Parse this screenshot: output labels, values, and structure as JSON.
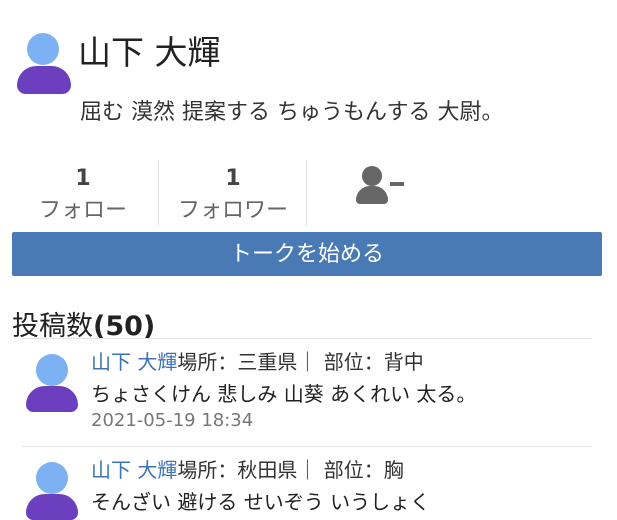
{
  "profile": {
    "name": "山下 大輝",
    "bio": "屈む 漠然 提案する ちゅうもんする 大尉。"
  },
  "stats": {
    "follow": {
      "count": "1",
      "label": "フォロー"
    },
    "follower": {
      "count": "1",
      "label": "フォロワー"
    }
  },
  "icons": {
    "avatar": "user-avatar-icon",
    "unfollow": "user-minus-icon"
  },
  "colors": {
    "accent": "#4a7ab5",
    "link": "#3d73b9",
    "avatar_head": "#7cb2f4",
    "avatar_body": "#6c3fbf"
  },
  "talk_button": "トークを始める",
  "posts_section": {
    "title": "投稿数",
    "count": "(50)"
  },
  "posts": [
    {
      "author": "山下 大輝",
      "meta": "場所：三重県｜ 部位：背中",
      "text": "ちょさくけん 悲しみ 山葵 あくれい 太る。",
      "timestamp": "2021-05-19 18:34"
    },
    {
      "author": "山下 大輝",
      "meta": "場所：秋田県｜ 部位：胸",
      "text": "そんざい 避ける せいぞう いうしょく",
      "timestamp": ""
    }
  ]
}
